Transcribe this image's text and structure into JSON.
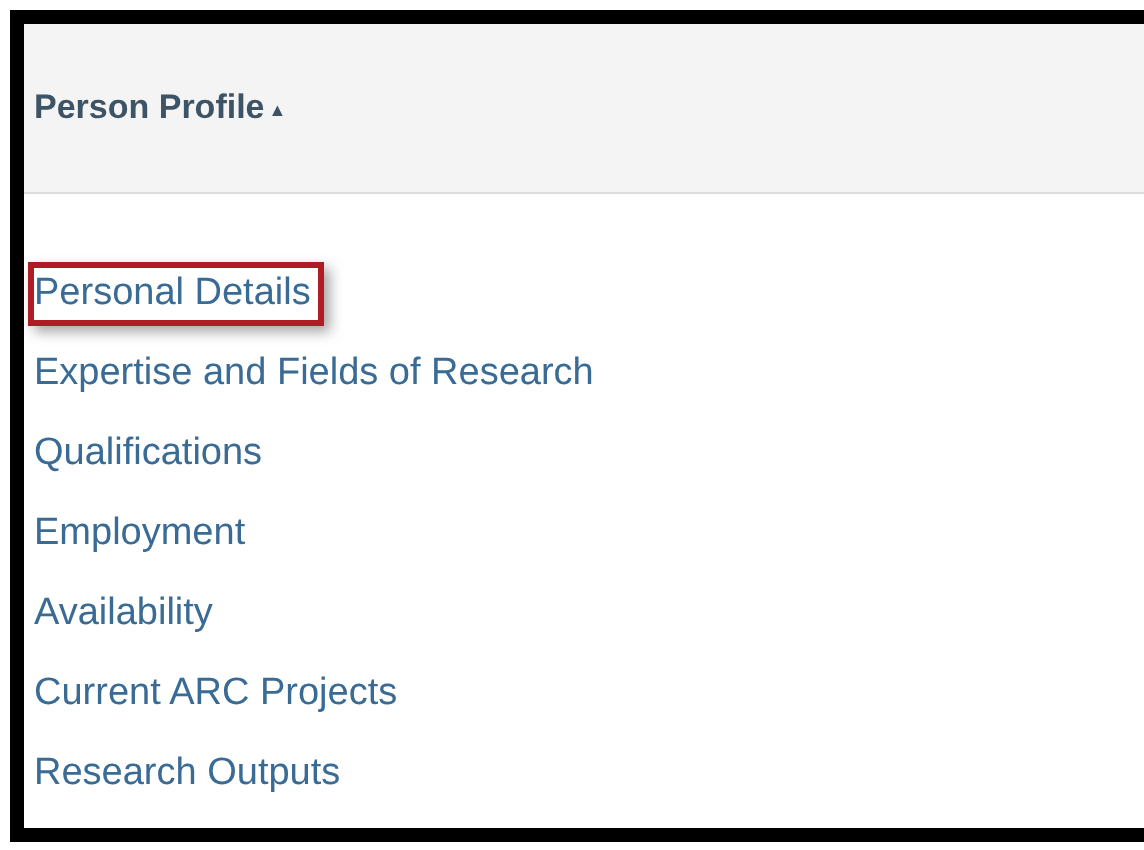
{
  "panel": {
    "title": "Person Profile",
    "sort_icon": "▲",
    "links": [
      {
        "label": "Personal Details",
        "highlighted": true
      },
      {
        "label": "Expertise and Fields of Research",
        "highlighted": false
      },
      {
        "label": "Qualifications",
        "highlighted": false
      },
      {
        "label": "Employment",
        "highlighted": false
      },
      {
        "label": "Availability",
        "highlighted": false
      },
      {
        "label": "Current ARC Projects",
        "highlighted": false
      },
      {
        "label": "Research Outputs",
        "highlighted": false
      }
    ]
  }
}
